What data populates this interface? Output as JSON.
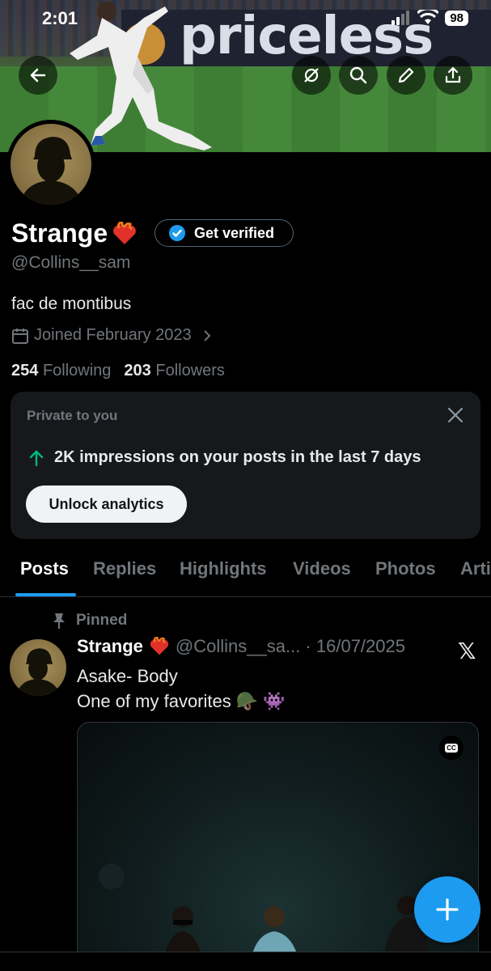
{
  "status": {
    "time": "2:01",
    "battery": "98"
  },
  "banner": {
    "ad_text": "priceless"
  },
  "profile": {
    "name": "Strange",
    "handle": "@Collins__sam",
    "bio": "fac de montibus",
    "joined": "Joined February 2023",
    "following_count": "254",
    "following_label": "Following",
    "followers_count": "203",
    "followers_label": "Followers",
    "verify_label": "Get verified"
  },
  "private_card": {
    "title": "Private to you",
    "impressions": "2K impressions on your posts in the last 7 days",
    "button": "Unlock analytics"
  },
  "tabs": [
    "Posts",
    "Replies",
    "Highlights",
    "Videos",
    "Photos",
    "Arti"
  ],
  "post": {
    "pinned_label": "Pinned",
    "author": "Strange",
    "meta": "@Collins__sa... · 16/07/2025",
    "line1": "Asake- Body",
    "line2": "One of my favorites 🪖 👾",
    "cc": "CC"
  },
  "colors": {
    "accent": "#1d9bf0",
    "background": "#000000",
    "muted": "#71767b",
    "card": "#16181c"
  }
}
